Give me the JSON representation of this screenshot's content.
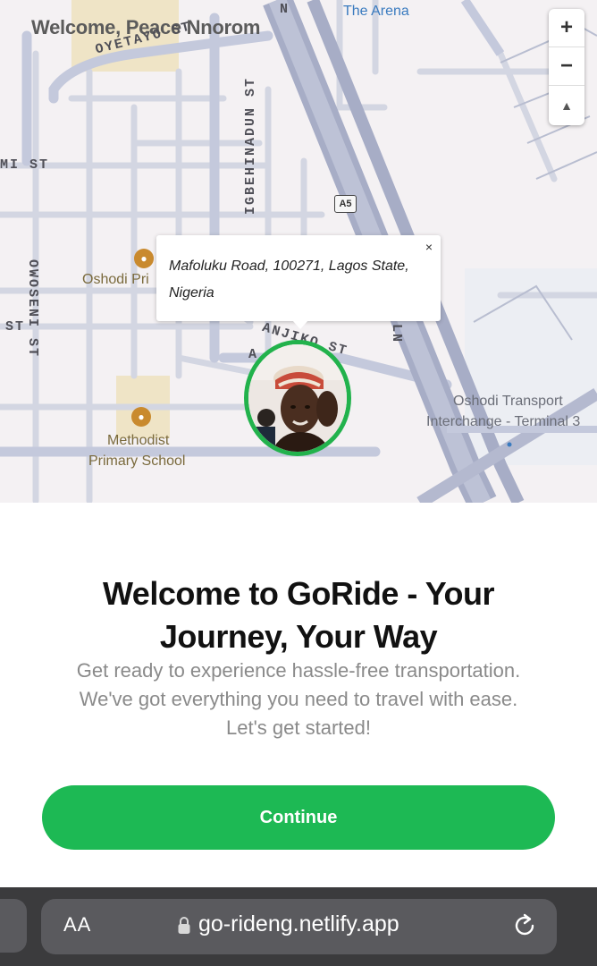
{
  "map": {
    "welcome_text": "Welcome, Peace Nnorom",
    "streets": {
      "oyetayo": "OYETAYO ST",
      "igbehinadun": "IGBEHINADUN ST",
      "owoseni": "OWOSENI ST",
      "mi_st": "MI ST",
      "st_left": "ST",
      "anjiko": "ANJIKO ST",
      "ln_top": "N",
      "ln_mid": "LN",
      "a_letter": "A"
    },
    "places": {
      "the_arena": "The Arena",
      "oshodi_pri": "Oshodi Pri",
      "methodist_line1": "Methodist",
      "methodist_line2": "Primary School",
      "transport_line1": "Oshodi Transport",
      "transport_line2": "Interchange - Terminal 3"
    },
    "route_shield": "A5",
    "zoom_in": "+",
    "zoom_out": "−",
    "compass": "▲",
    "popup": {
      "address": "Mafoluku Road, 100271, Lagos State, Nigeria",
      "close": "×"
    },
    "marker_color": "#22b24c"
  },
  "welcome": {
    "title": "Welcome to GoRide - Your Journey, Your Way",
    "subtitle": "Get ready to experience hassle-free transportation. We've got everything you need to travel with ease. Let's get started!",
    "continue_label": "Continue",
    "accent_color": "#1db954"
  },
  "browser": {
    "aa_label": "AA",
    "url": "go-rideng.netlify.app"
  }
}
